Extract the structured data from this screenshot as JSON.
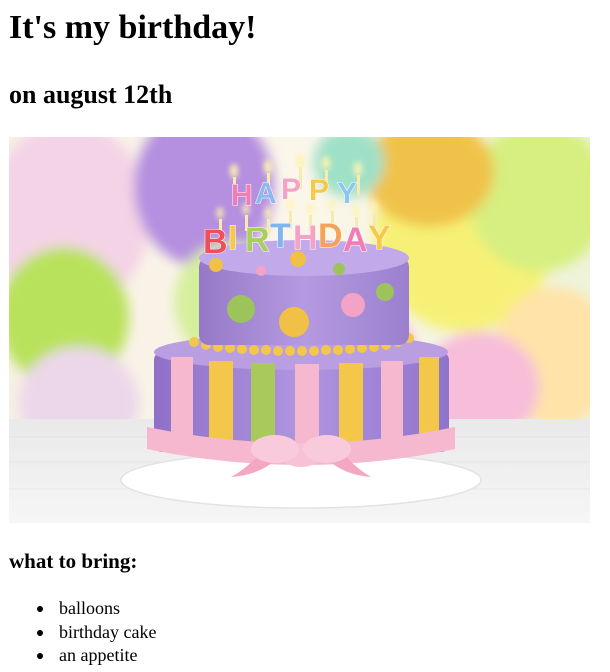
{
  "page": {
    "title": "It's my birthday!",
    "subtitle": "on august 12th"
  },
  "hero_image": {
    "candle_letters": [
      "H",
      "A",
      "P",
      "P",
      "Y",
      "B",
      "I",
      "R",
      "T",
      "H",
      "D",
      "A",
      "Y"
    ],
    "colors": {
      "cake_top": "#a887d6",
      "cake_bottom": "#9a7fd6",
      "ribbon": "#f6b8cf",
      "stripe_yellow": "#f3c84a",
      "stripe_green": "#a9c95a",
      "dot_yellow": "#f1c046",
      "dot_green": "#9cc45a",
      "dot_pink": "#f2a3c6"
    }
  },
  "bring": {
    "heading": "what to bring:",
    "items": [
      "balloons",
      "birthday cake",
      "an appetite"
    ]
  }
}
